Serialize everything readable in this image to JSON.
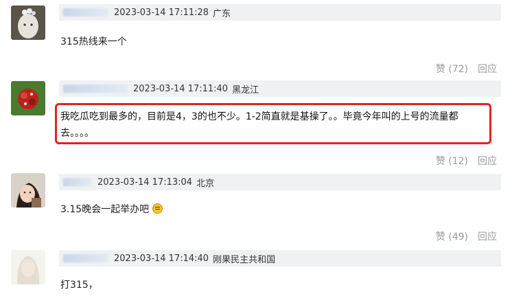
{
  "comments": [
    {
      "timestamp": "2023-03-14 17:11:28",
      "location": "广东",
      "text": "315热线来一个",
      "likes": "赞 (72)",
      "reply": "回应"
    },
    {
      "timestamp": "2023-03-14 17:11:40",
      "location": "黑龙江",
      "text": "我吃瓜吃到最多的，目前是4，3的也不少。1-2简直就是基操了。。毕竟今年叫的上号的流量都去。。。。",
      "likes": "赞 (12)",
      "reply": "回应"
    },
    {
      "timestamp": "2023-03-14 17:13:04",
      "location": "北京",
      "text": "3.15晚会一起举办吧",
      "likes": "赞 (49)",
      "reply": "回应"
    },
    {
      "timestamp": "2023-03-14 17:14:40",
      "location": "刚果民主共和国",
      "text": "打315，"
    }
  ],
  "icons": {
    "emoji": "grimace-emoji",
    "avatar": "user-avatar"
  },
  "colors": {
    "highlight_border": "#e22222",
    "header_bg": "#f0f1f3",
    "action_text": "#9a9a9a"
  }
}
